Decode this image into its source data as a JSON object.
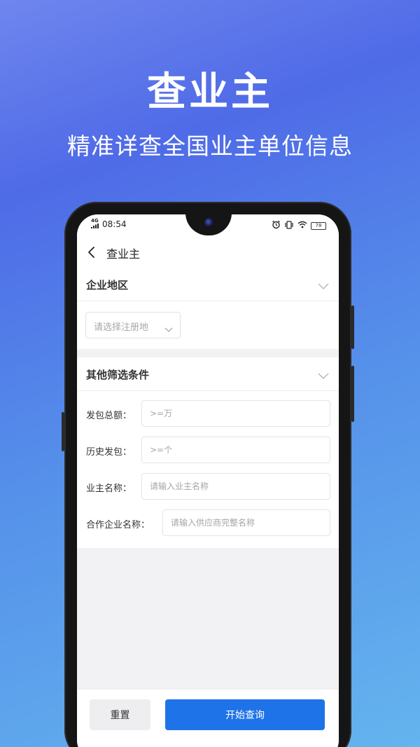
{
  "hero": {
    "title": "查业主",
    "subtitle": "精准详查全国业主单位信息"
  },
  "status_bar": {
    "network": "4G",
    "time": "08:54",
    "battery": "78",
    "icons": [
      "alarm-icon",
      "vibrate-icon",
      "wifi-icon",
      "battery-icon"
    ]
  },
  "nav": {
    "title": "查业主"
  },
  "sections": {
    "region": {
      "title": "企业地区",
      "select_placeholder": "请选择注册地"
    },
    "filters": {
      "title": "其他筛选条件",
      "fields": [
        {
          "label": "发包总额：",
          "placeholder": ">=万"
        },
        {
          "label": "历史发包：",
          "placeholder": ">=个"
        },
        {
          "label": "业主名称：",
          "placeholder": "请输入业主名称"
        },
        {
          "label": "合作企业名称：",
          "placeholder": "请输入供应商完整名称"
        }
      ]
    }
  },
  "buttons": {
    "reset": "重置",
    "search": "开始查询"
  },
  "colors": {
    "accent": "#1f73e8",
    "background_top": "#4f6be7",
    "background_bottom": "#64b4ee"
  }
}
